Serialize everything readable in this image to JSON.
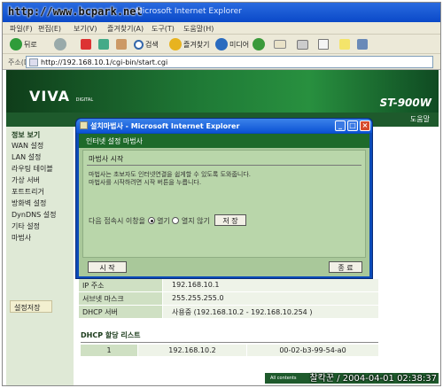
{
  "browser": {
    "watermark": "http://www.bcpark.net",
    "title": "Microsoft Internet Explorer",
    "menu": [
      "파일(F)",
      "편집(E)",
      "보기(V)",
      "즐겨찾기(A)",
      "도구(T)",
      "도움말(H)"
    ],
    "toolbar": {
      "back": "뒤로",
      "search": "검색",
      "favorites": "즐겨찾기",
      "media": "미디어"
    },
    "address_label": "주소(D)",
    "address": "http://192.168.10.1/cgi-bin/start.cgi"
  },
  "page": {
    "brand": "VIVA",
    "brand_sub": "DIGITAL",
    "model": "ST-900W",
    "help": "도움말",
    "sidebar": {
      "heading": "정보 보기",
      "items": [
        "WAN 설정",
        "LAN 설정",
        "라우팅 테이블",
        "가상 서버",
        "포트트리거",
        "방화벽 설정",
        "DynDNS 설정",
        "기타 설정",
        "마법사"
      ],
      "save": "설정저장"
    },
    "lan_table": [
      {
        "key": "IP 주소",
        "value": "192.168.10.1"
      },
      {
        "key": "서브넷 마스크",
        "value": "255.255.255.0"
      },
      {
        "key": "DHCP 서버",
        "value": "사용중 (192.168.10.2 - 192.168.10.254 )"
      }
    ],
    "dhcp": {
      "title": "DHCP 할당 리스트",
      "rows": [
        {
          "no": "1",
          "ip": "192.168.10.2",
          "mac": "00-02-b3-99-54-a0"
        }
      ]
    },
    "footer": "All contents"
  },
  "dialog": {
    "title": "설치마법사 - Microsoft Internet Explorer",
    "header": "인터넷 설정 마법사",
    "subtitle": "마법사 시작",
    "line1": "마법사는 초보자도 인터넷연결을 쉽게할 수 있도록 도와줍니다.",
    "line2": "마법사를 시작하려면 시작 버튼을 누릅니다.",
    "option_label": "다음 접속시 이창을",
    "opt_open": "열기",
    "opt_close": "열지 않기",
    "save_btn": "저  장",
    "start_btn": "시  작",
    "exit_btn": "종  료"
  },
  "stamp": "찰칵꾼 / 2004-04-01 02:38:37"
}
